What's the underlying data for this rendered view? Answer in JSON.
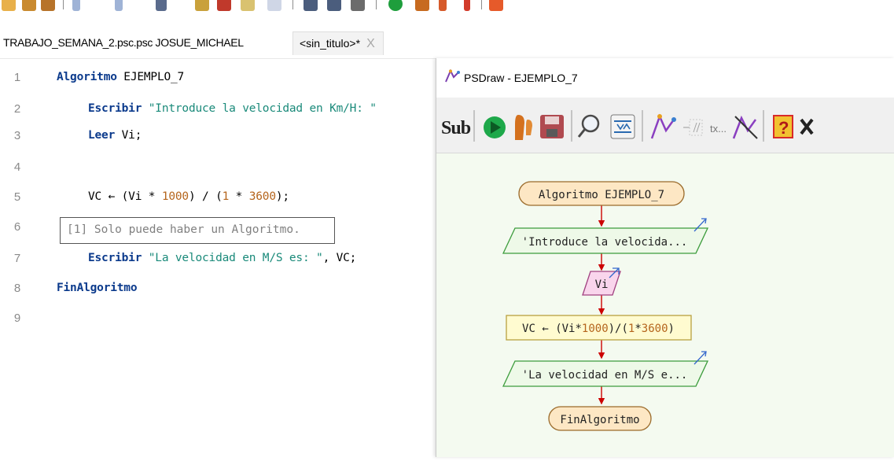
{
  "tabs": {
    "file_tab": "TRABAJO_SEMANA_2.psc.psc JOSUE_MICHAEL",
    "active_tab": "<sin_titulo>*",
    "close_glyph": "X"
  },
  "editor": {
    "line_numbers": [
      "1",
      "2",
      "3",
      "4",
      "5",
      "6",
      "7",
      "8",
      "9"
    ],
    "line1_kw": "Algoritmo",
    "line1_rest": " EJEMPLO_7",
    "line2_kw": "Escribir",
    "line2_str": "\"Introduce la velocidad en Km/H: \"",
    "line3_kw": "Leer",
    "line3_rest": " Vi;",
    "line5_a": "VC ← (Vi * ",
    "line5_n1": "1000",
    "line5_b": ") / (",
    "line5_n2": "1",
    "line5_c": " * ",
    "line5_n3": "3600",
    "line5_d": ");",
    "line7_kw": "Escribir",
    "line7_str": "\"La velocidad en M/S es: \"",
    "line7_rest": ", VC;",
    "line8_kw": "FinAlgoritmo",
    "tooltip": "[1] Solo puede haber un Algoritmo."
  },
  "psdraw": {
    "title": "PSDraw - EJEMPLO_7",
    "toolbar_sub_label": "Sub",
    "toolbar_tx_label": "tx...",
    "flow": {
      "start": "Algoritmo EJEMPLO_7",
      "output1": "'Introduce la velocida...",
      "input1": "Vi",
      "process1_a": "VC ← (Vi*",
      "process1_n1": "1000",
      "process1_b": ")/(",
      "process1_n2": "1",
      "process1_c": "*",
      "process1_n3": "3600",
      "process1_d": ")",
      "output2": "'La velocidad en M/S e...",
      "end": "FinAlgoritmo"
    }
  },
  "colors": {
    "keyword": "#0b3a8c",
    "string": "#1a8a7a",
    "number": "#b5651d",
    "flow_arrow": "#cc0000",
    "terminal_fill": "#fde7c4",
    "terminal_stroke": "#9a6a2a",
    "io_stroke": "#3c9c3c",
    "input_fill": "#f9d5ec",
    "input_stroke": "#a04080",
    "process_fill": "#fffbd0",
    "process_stroke": "#b8a040"
  }
}
